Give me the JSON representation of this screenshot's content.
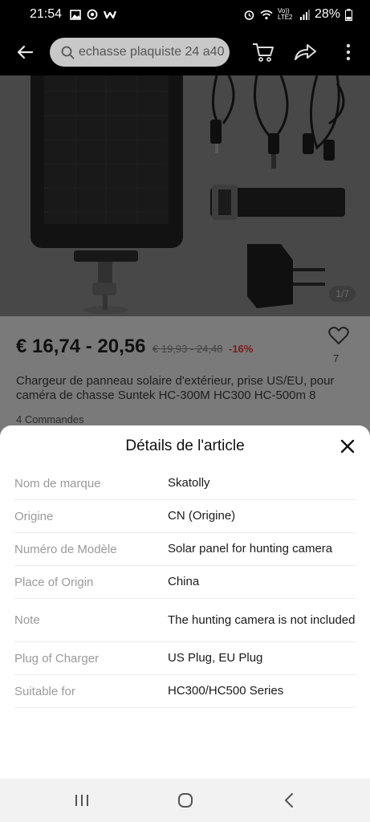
{
  "status_bar": {
    "time": "21:54",
    "battery": "28%",
    "network": "Vo)) LTE2",
    "icons": [
      "gallery-icon",
      "screen-record-icon",
      "app-w-icon",
      "alarm-icon",
      "wifi-icon",
      "signal-icon",
      "battery-icon"
    ]
  },
  "header": {
    "search_placeholder": "echasse plaquiste 24 a40",
    "icons": [
      "back-arrow-icon",
      "search-icon",
      "cart-icon",
      "share-icon",
      "more-vertical-icon"
    ]
  },
  "gallery": {
    "page_indicator": "1/7"
  },
  "product": {
    "price": "€ 16,74 - 20,56",
    "old_price": "€ 19,93 - 24,48",
    "discount": "-16%",
    "wishlist_count": "7",
    "title": "Chargeur de panneau solaire d'extérieur, prise US/EU, pour caméra de chasse Suntek HC-300M HC300 HC-500m 8",
    "orders": "4 Commandes"
  },
  "sheet": {
    "title": "Détails de l'article",
    "specs": [
      {
        "label": "Nom de marque",
        "value": "Skatolly"
      },
      {
        "label": "Origine",
        "value": "CN (Origine)"
      },
      {
        "label": "Numéro de Modèle",
        "value": "Solar panel for hunting camera"
      },
      {
        "label": "Place of Origin",
        "value": "China"
      },
      {
        "label": "Note",
        "value": "The hunting camera is not included"
      },
      {
        "label": "Plug of Charger",
        "value": "US Plug, EU Plug"
      },
      {
        "label": "Suitable for",
        "value": "HC300/HC500 Series"
      }
    ]
  },
  "nav_bar": {
    "icons": [
      "recent-apps-icon",
      "home-icon",
      "back-icon"
    ]
  }
}
